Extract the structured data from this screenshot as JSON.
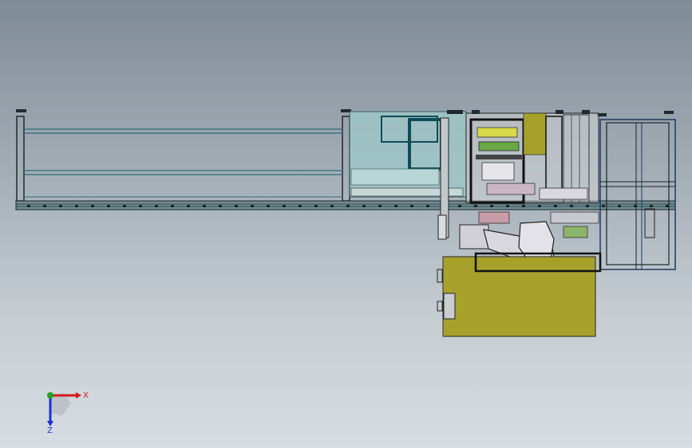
{
  "viewport": {
    "background_top": "#7f8b96",
    "background_bottom": "#d6dde2"
  },
  "triad": {
    "x_label": "X",
    "z_label": "Z",
    "x_color": "#d41a1a",
    "y_color": "#1fa31f",
    "z_color": "#1a2fd4"
  },
  "model": {
    "colors": {
      "frame": "#1d2a2e",
      "rail": "#2c6b73",
      "glass": "#9fc9c9",
      "base": "#a7a12c",
      "green_part": "#6aa845",
      "pink_part": "#c89ca8",
      "dark_cyan": "#0f4c57",
      "robot": "#d8d8de"
    }
  }
}
